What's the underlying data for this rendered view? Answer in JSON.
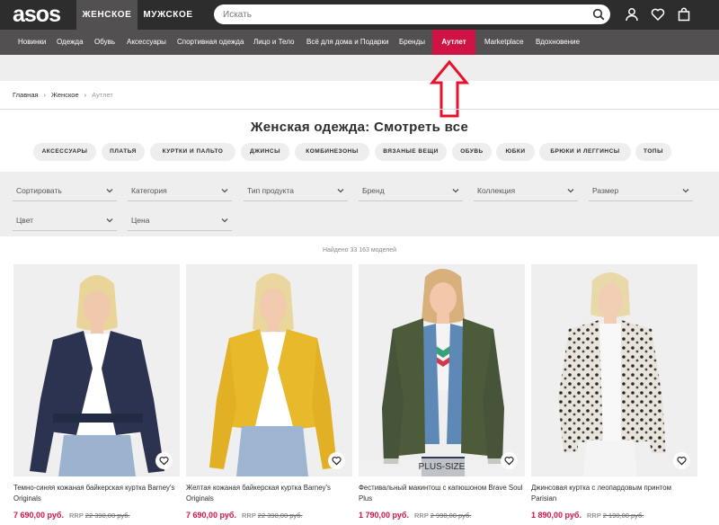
{
  "header": {
    "logo": "asos",
    "gender_tabs": [
      "ЖЕНСКОЕ",
      "МУЖСКОЕ"
    ],
    "search_placeholder": "Искать",
    "icons": [
      "search-icon",
      "account-icon",
      "heart-icon",
      "bag-icon"
    ]
  },
  "nav": {
    "items": [
      "Новинки",
      "Одежда",
      "Обувь",
      "Аксессуары",
      "Спортивная одежда",
      "Лицо и Тело",
      "Всё для дома и Подарки",
      "Бренды",
      "Аутлет",
      "Marketplace",
      "Вдохновение"
    ],
    "active": "Аутлет",
    "active_color": "#d01345"
  },
  "breadcrumb": [
    "Главная",
    "Женское",
    "Аутлет"
  ],
  "title": "Женская одежда: Смотреть все",
  "chips": [
    "АКСЕССУАРЫ",
    "ПЛАТЬЯ",
    "КУРТКИ И ПАЛЬТО",
    "ДЖИНСЫ",
    "КОМБИНЕЗОНЫ",
    "ВЯЗАНЫЕ ВЕЩИ",
    "ОБУВЬ",
    "ЮБКИ",
    "БРЮКИ И ЛЕГГИНСЫ",
    "ТОПЫ"
  ],
  "filters": [
    "Сортировать",
    "Категория",
    "Тип продукта",
    "Бренд",
    "Коллекция",
    "Размер",
    "Цвет",
    "Цена"
  ],
  "results_count": "Найдено 33 163 моделей",
  "products": [
    {
      "name": "Темно-синяя кожаная байкерская куртка Barney's Originals",
      "price": "7 690,00 руб.",
      "rrp_label": "RRP",
      "rrp": "22 390,00 руб.",
      "badge": ""
    },
    {
      "name": "Желтая кожаная байкерская куртка Barney's Originals",
      "price": "7 690,00 руб.",
      "rrp_label": "RRP",
      "rrp": "22 390,00 руб.",
      "badge": ""
    },
    {
      "name": "Фестивальный макинтош с капюшоном Brave Soul Plus",
      "price": "1 790,00 руб.",
      "rrp_label": "RRP",
      "rrp": "2 990,00 руб.",
      "badge": "PLUS-SIZE"
    },
    {
      "name": "Джинсовая куртка с леопардовым принтом Parisian",
      "price": "1 890,00 руб.",
      "rrp_label": "RRP",
      "rrp": "2 190,00 руб.",
      "badge": ""
    }
  ],
  "colors": {
    "header_bg": "#2d2d2d",
    "nav_bg": "#525050",
    "sale_red": "#d01345",
    "annotation_arrow": "#e8112d"
  }
}
